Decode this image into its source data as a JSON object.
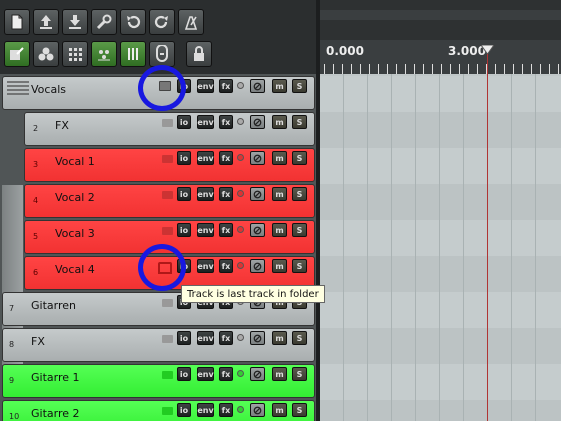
{
  "toolbar": {
    "buttons": [
      {
        "icon": "new-project-icon"
      },
      {
        "icon": "open-project-icon"
      },
      {
        "icon": "save-project-icon"
      },
      {
        "icon": "wrench-icon"
      },
      {
        "icon": "undo-icon"
      },
      {
        "icon": "redo-icon"
      },
      {
        "icon": "metronome-icon"
      },
      {
        "icon": "snap-icon"
      },
      {
        "icon": "ripple-icon"
      },
      {
        "icon": "grid-icon"
      },
      {
        "icon": "envelope-lock-icon"
      },
      {
        "icon": "item-lock-icon"
      },
      {
        "icon": "shield-icon"
      },
      {
        "icon": "lock-icon"
      }
    ]
  },
  "tracks": [
    {
      "number": "",
      "name": "Vocals",
      "color": "gray",
      "folder_state": "folder-parent"
    },
    {
      "number": "2",
      "name": "FX",
      "color": "gray",
      "folder_state": "normal"
    },
    {
      "number": "3",
      "name": "Vocal 1",
      "color": "red",
      "folder_state": "normal"
    },
    {
      "number": "4",
      "name": "Vocal 2",
      "color": "red",
      "folder_state": "normal"
    },
    {
      "number": "5",
      "name": "Vocal 3",
      "color": "red",
      "folder_state": "normal"
    },
    {
      "number": "6",
      "name": "Vocal 4",
      "color": "red",
      "folder_state": "last-in-folder"
    },
    {
      "number": "7",
      "name": "Gitarren",
      "color": "gray",
      "folder_state": "normal"
    },
    {
      "number": "8",
      "name": "FX",
      "color": "gray",
      "folder_state": "normal"
    },
    {
      "number": "9",
      "name": "Gitarre 1",
      "color": "green",
      "folder_state": "normal"
    },
    {
      "number": "10",
      "name": "Gitarre 2",
      "color": "green",
      "folder_state": "normal"
    }
  ],
  "track_controls": {
    "io": "io",
    "env": "env",
    "fx": "fx",
    "mute": "m",
    "solo": "S"
  },
  "ruler": {
    "labels": [
      "0.000",
      "3.000"
    ]
  },
  "tooltip": "Track is last track in folder",
  "colors": {
    "track_red": "#ff3b3b",
    "track_green": "#44f544",
    "track_gray": "#b8bdbe",
    "annotation": "#1818e0",
    "playhead": "#b03434"
  }
}
